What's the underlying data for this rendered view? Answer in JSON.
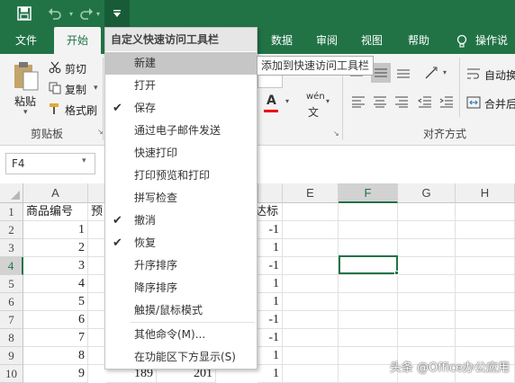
{
  "qat": {
    "save_icon": "save-icon",
    "undo_icon": "undo-icon",
    "redo_icon": "redo-icon",
    "customize_icon": "customize-dropdown-icon"
  },
  "tabs": [
    {
      "label": "文件"
    },
    {
      "label": "开始"
    },
    {
      "label": "数据"
    },
    {
      "label": "审阅"
    },
    {
      "label": "视图"
    },
    {
      "label": "帮助"
    },
    {
      "label": "操作说"
    }
  ],
  "ribbon": {
    "clipboard": {
      "paste": "粘贴",
      "cut": "剪切",
      "copy": "复制",
      "format_painter": "格式刷",
      "group_label": "剪贴板"
    },
    "alignment": {
      "wrap": "自动换",
      "merge": "合并后",
      "group_label": "对齐方式"
    },
    "font_sample": "wén"
  },
  "namebox": {
    "value": "F4"
  },
  "columns": [
    "A",
    "",
    "",
    "",
    "E",
    "F",
    "G",
    "H"
  ],
  "col_headers_visible": [
    "A",
    "E",
    "F",
    "G",
    "H"
  ],
  "rows": [
    {
      "n": "1",
      "a": "商品编号",
      "b": "预",
      "d": "达标"
    },
    {
      "n": "2",
      "a": "1",
      "d": "-1"
    },
    {
      "n": "3",
      "a": "2",
      "d": "1"
    },
    {
      "n": "4",
      "a": "3",
      "d": "-1"
    },
    {
      "n": "5",
      "a": "4",
      "d": "1"
    },
    {
      "n": "6",
      "a": "5",
      "d": "1"
    },
    {
      "n": "7",
      "a": "6",
      "d": "-1"
    },
    {
      "n": "8",
      "a": "7",
      "d": "-1"
    },
    {
      "n": "9",
      "a": "8",
      "d": "1"
    },
    {
      "n": "10",
      "a": "9",
      "b": "189",
      "c": "201",
      "d": "1"
    }
  ],
  "menu": {
    "title": "自定义快速访问工具栏",
    "items": [
      {
        "label": "新建",
        "checked": false
      },
      {
        "label": "打开",
        "checked": false
      },
      {
        "label": "保存",
        "checked": true
      },
      {
        "label": "通过电子邮件发送",
        "checked": false
      },
      {
        "label": "快速打印",
        "checked": false
      },
      {
        "label": "打印预览和打印",
        "checked": false
      },
      {
        "label": "拼写检查",
        "checked": false
      },
      {
        "label": "撤消",
        "checked": true
      },
      {
        "label": "恢复",
        "checked": true
      },
      {
        "label": "升序排序",
        "checked": false
      },
      {
        "label": "降序排序",
        "checked": false
      },
      {
        "label": "触摸/鼠标模式",
        "checked": false
      },
      {
        "label": "其他命令(M)...",
        "checked": false
      },
      {
        "label": "在功能区下方显示(S)",
        "checked": false
      }
    ]
  },
  "tooltip": "添加到快速访问工具栏",
  "watermark": "头条 @Office办公应用",
  "colors": {
    "excel_green": "#217346",
    "selection_green": "#217346"
  }
}
